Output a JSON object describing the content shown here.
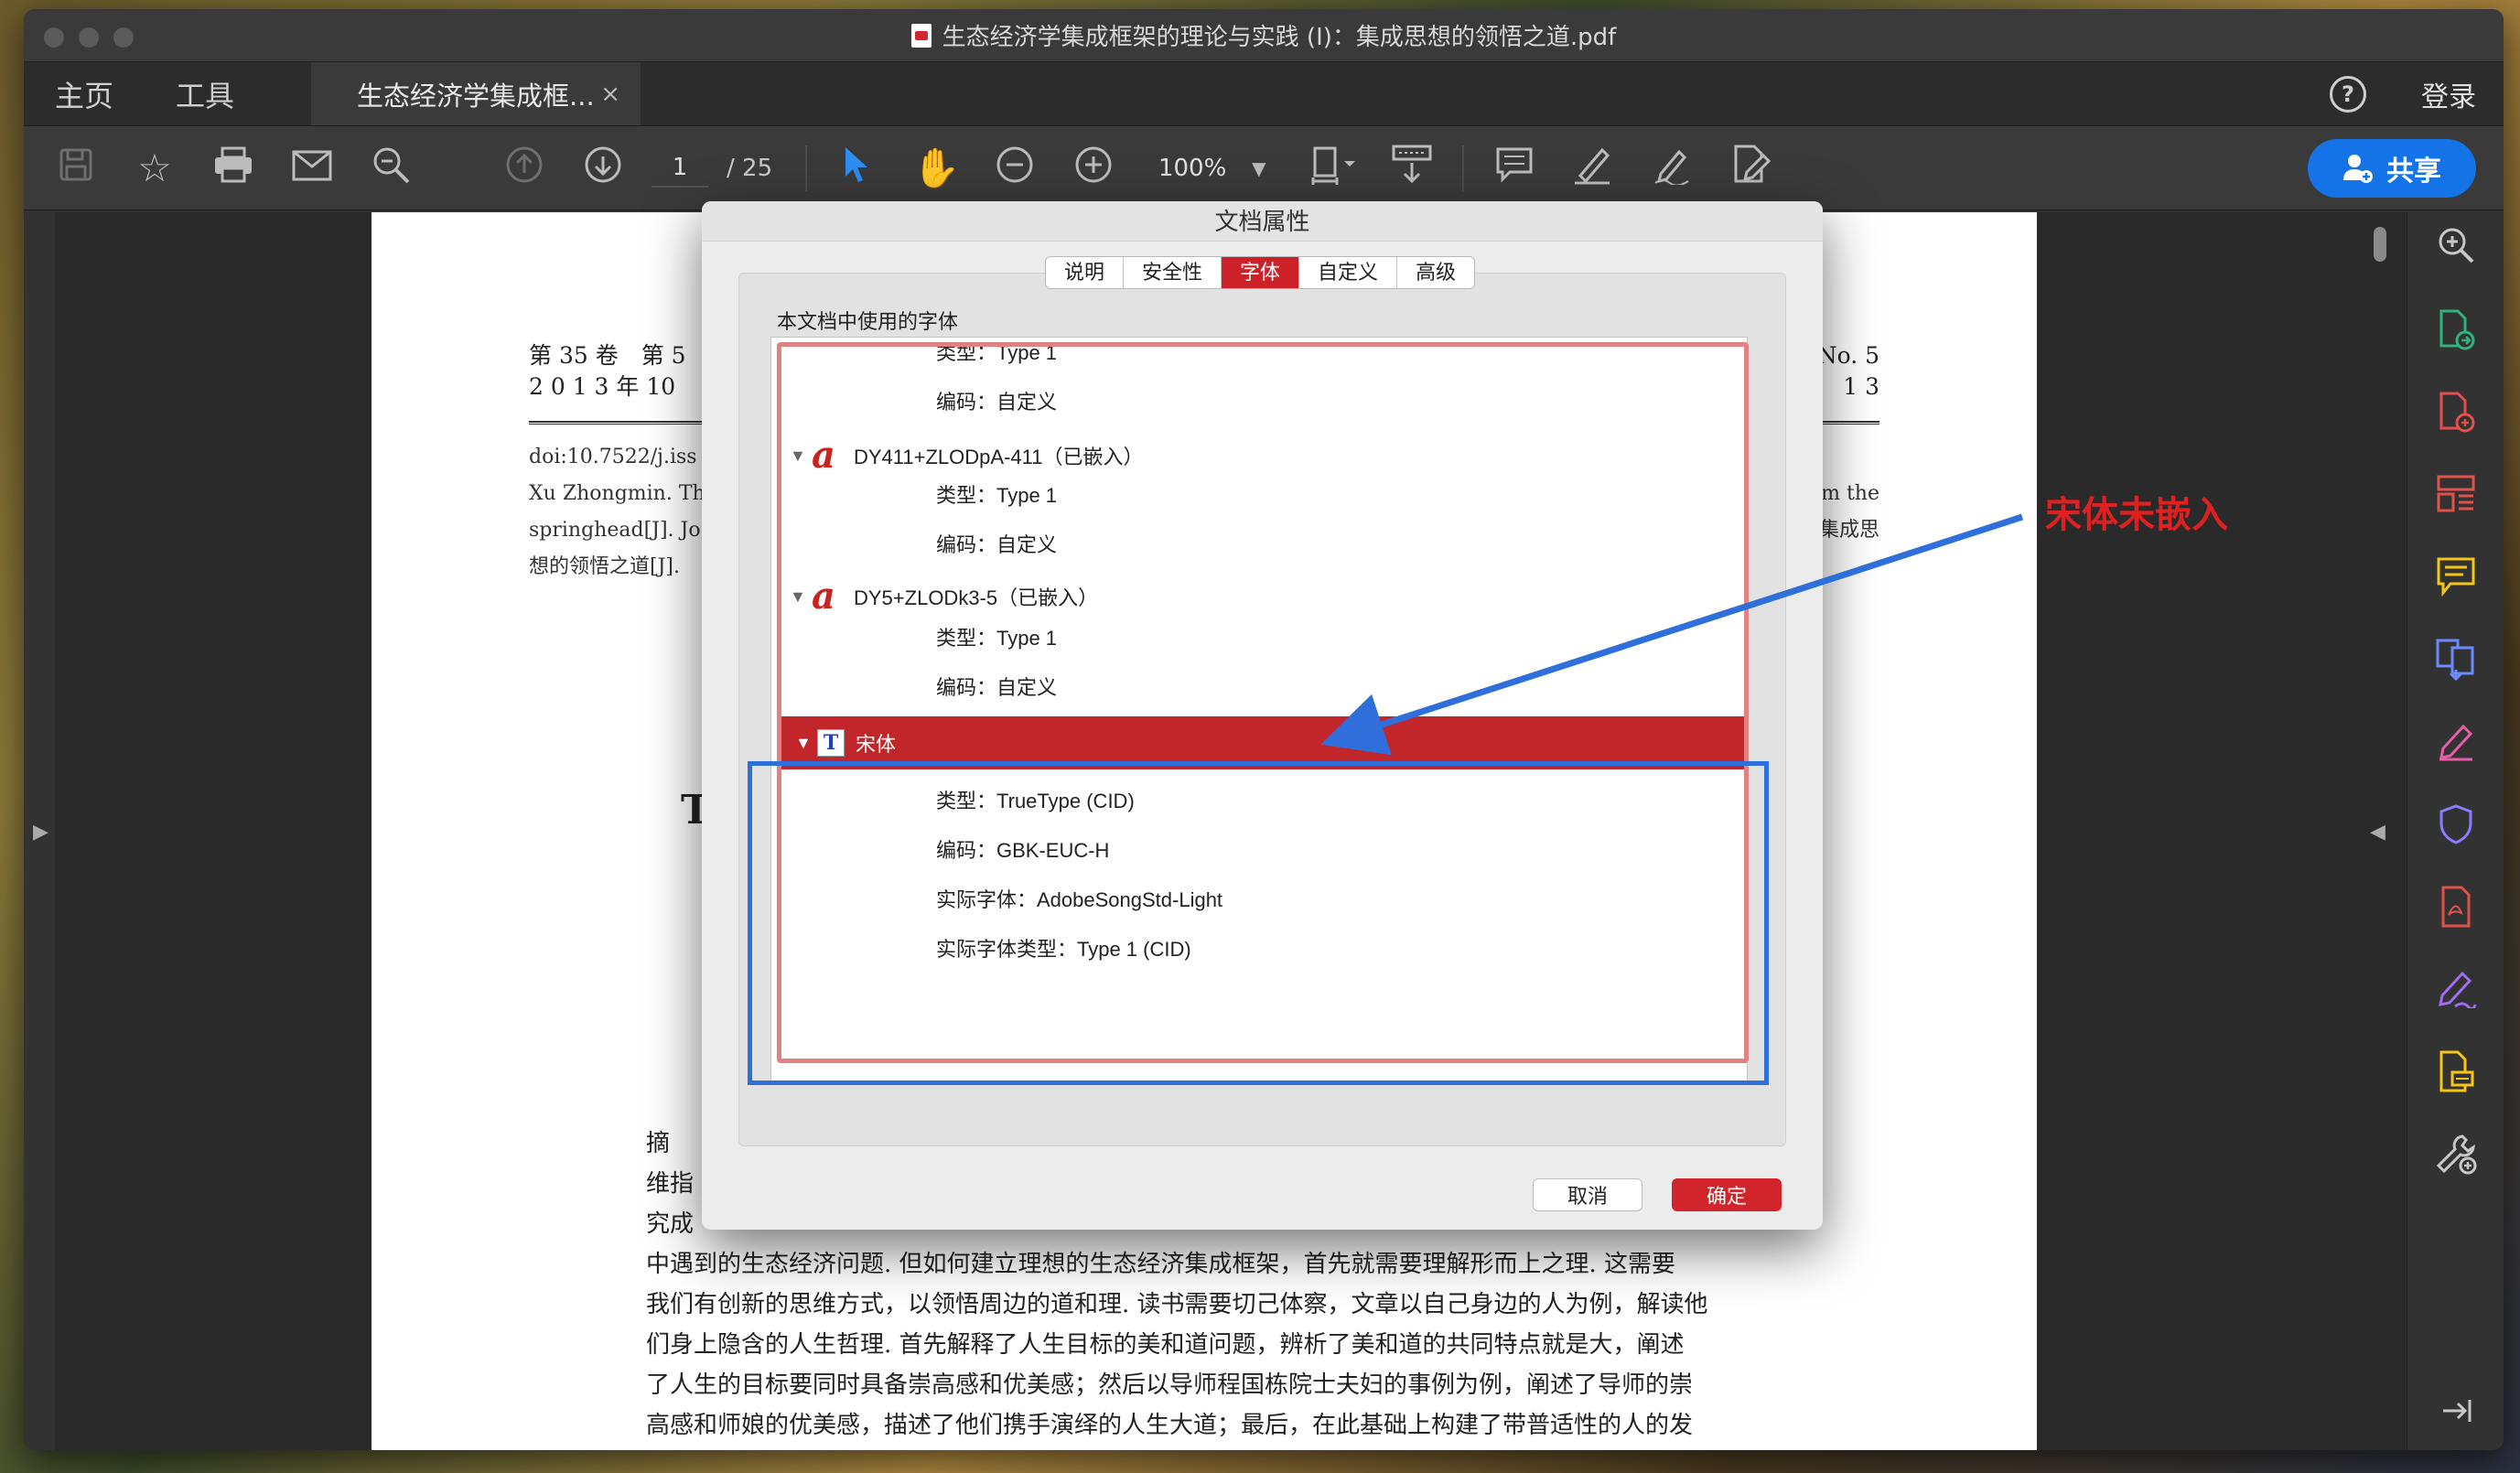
{
  "window": {
    "title": "生态经济学集成框架的理论与实践 (I)：集成思想的领悟之道.pdf"
  },
  "tabs": {
    "home": "主页",
    "tools": "工具",
    "doc": "生态经济学集成框...",
    "close": "×",
    "help": "?",
    "login": "登录"
  },
  "toolbar": {
    "page_current": "1",
    "page_total": "/ 25",
    "zoom": "100%",
    "share": "共享"
  },
  "document": {
    "header_left_1": "第 35 卷　第 5",
    "header_left_2": "2 0 1 3 年 10",
    "header_right_1": "No. 5",
    "header_right_2": "1 3",
    "meta_1": "doi:10.7522/j.iss",
    "meta_2": "Xu Zhongmin. Th",
    "meta_3": "springhead[J]. Jo",
    "meta_4": "想的领悟之道[J].",
    "meta_r1": "m the",
    "meta_r2": "集成思",
    "big_letter": "T",
    "abstract_lines": [
      "摘　",
      "维指",
      "究成",
      "中遇到的生态经济问题. 但如何建立理想的生态经济集成框架，首先就需要理解形而上之理. 这需要",
      "我们有创新的思维方式，以领悟周边的道和理. 读书需要切己体察，文章以自己身边的人为例，解读他",
      "们身上隐含的人生哲理. 首先解释了人生目标的美和道问题，辨析了美和道的共同特点就是大，阐述",
      "了人生的目标要同时具备崇高感和优美感；然后以导师程国栋院士夫妇的事例为例，阐述了导师的崇",
      "高感和师娘的优美感，描述了他们携手演绎的人生大道；最后，在此基础上构建了带普适性的人的发"
    ]
  },
  "dialog": {
    "title": "文档属性",
    "tabs": [
      "说明",
      "安全性",
      "字体",
      "自定义",
      "高级"
    ],
    "active_tab": "字体",
    "section_label": "本文档中使用的字体",
    "rows": [
      {
        "kind": "child",
        "text": "类型：Type 1"
      },
      {
        "kind": "child",
        "text": "编码：自定义"
      },
      {
        "kind": "parent",
        "icon": "a",
        "text": "DY411+ZLODpA-411（已嵌入）"
      },
      {
        "kind": "child",
        "text": "类型：Type 1"
      },
      {
        "kind": "child",
        "text": "编码：自定义"
      },
      {
        "kind": "parent",
        "icon": "a",
        "text": "DY5+ZLODk3-5（已嵌入）"
      },
      {
        "kind": "child",
        "text": "类型：Type 1"
      },
      {
        "kind": "child",
        "text": "编码：自定义"
      },
      {
        "kind": "parent-selected",
        "icon": "T",
        "text": "宋体"
      },
      {
        "kind": "child",
        "text": "类型：TrueType (CID)"
      },
      {
        "kind": "child",
        "text": "编码：GBK-EUC-H"
      },
      {
        "kind": "child",
        "text": "实际字体：AdobeSongStd-Light"
      },
      {
        "kind": "child",
        "text": "实际字体类型：Type 1 (CID)"
      }
    ],
    "cancel": "取消",
    "ok": "确定"
  },
  "annotation": {
    "text": "宋体未嵌入",
    "color": "#e02020",
    "box_color": "#2f6fdb"
  }
}
